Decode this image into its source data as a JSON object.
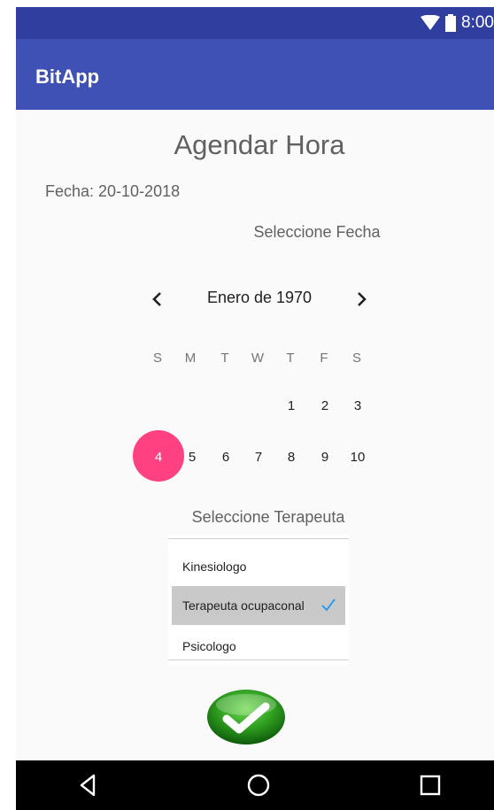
{
  "status_bar": {
    "time": "8:00"
  },
  "app_bar": {
    "title": "BitApp"
  },
  "page": {
    "title": "Agendar Hora",
    "date_label": "Fecha: 20-10-2018",
    "select_date_label": "Seleccione Fecha",
    "select_therapist_label": "Seleccione Terapeuta"
  },
  "calendar": {
    "month_label": "Enero de 1970",
    "weekdays": [
      "S",
      "M",
      "T",
      "W",
      "T",
      "F",
      "S"
    ],
    "week1": [
      "1",
      "2",
      "3"
    ],
    "week2": [
      "4",
      "5",
      "6",
      "7",
      "8",
      "9",
      "10"
    ],
    "selected_day": "4"
  },
  "therapists": {
    "items": [
      "Kinesiologo",
      "Terapeuta ocupaconal",
      "Psicologo"
    ],
    "selected": "Terapeuta ocupaconal"
  },
  "colors": {
    "status_bar": "#303f9f",
    "app_bar": "#3f51b5",
    "accent": "#ff4081",
    "check": "#2196f3",
    "confirm_green": "#2e9e1f"
  },
  "icons": {
    "prev": "chevron-left-icon",
    "next": "chevron-right-icon",
    "confirm": "checkmark-icon",
    "wifi": "wifi-icon",
    "battery": "battery-icon",
    "back": "back-triangle-icon",
    "home": "home-circle-icon",
    "recents": "recents-square-icon"
  }
}
